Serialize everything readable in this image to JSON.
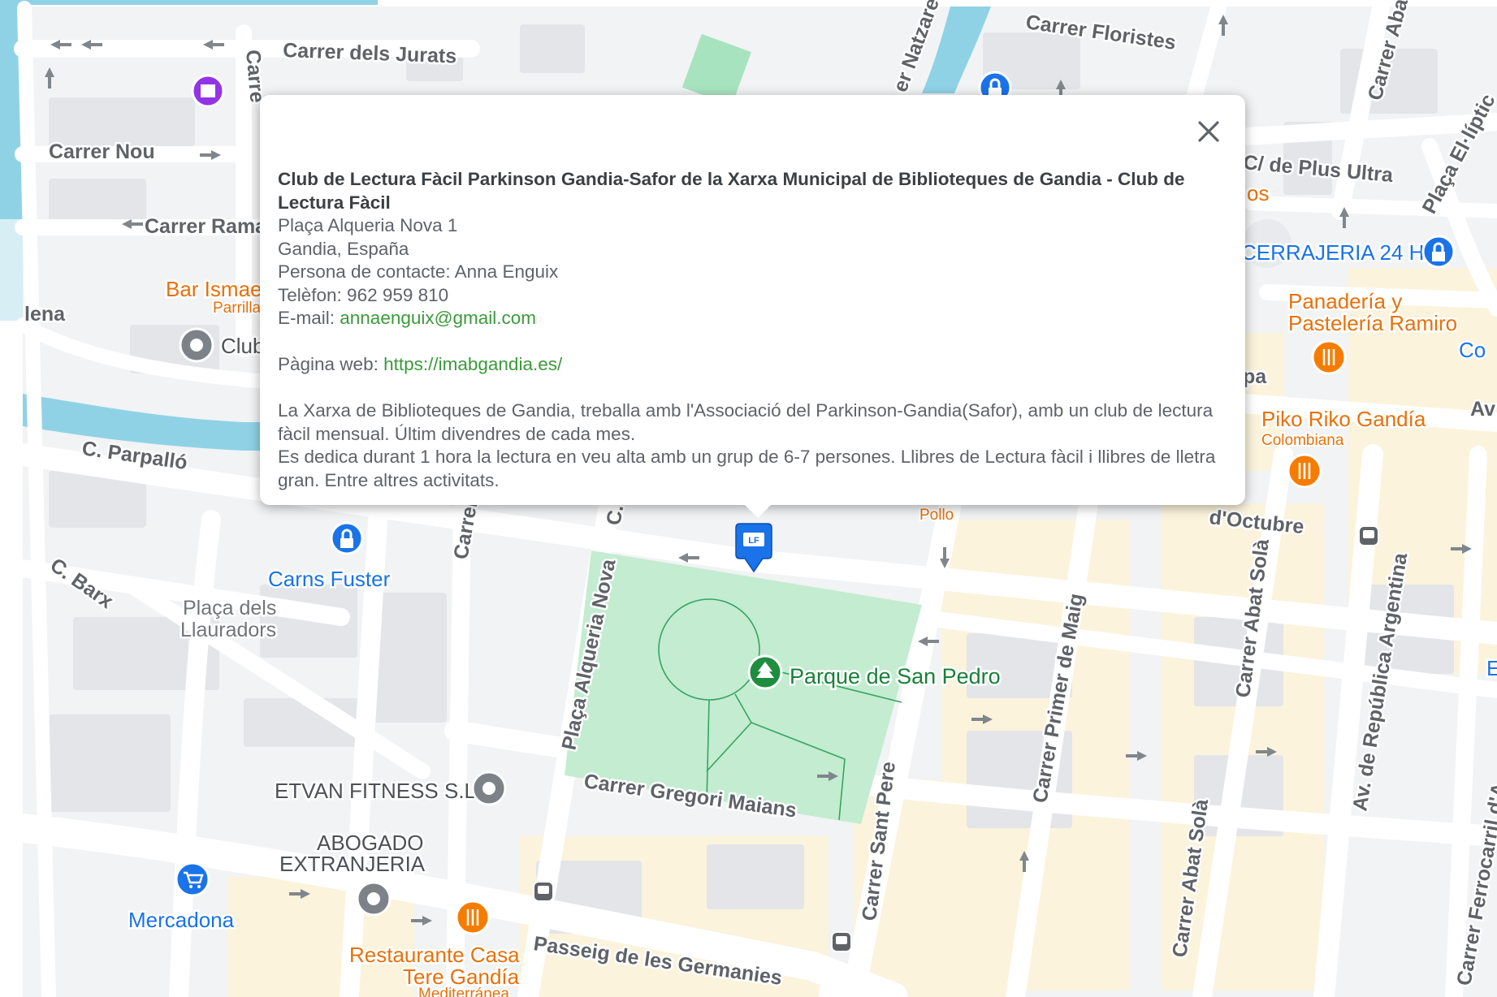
{
  "map": {
    "streets": {
      "jurats": "Carrer dels Jurats",
      "floristes": "Carrer Floristes",
      "natzare": "er Natzare",
      "abat_top": "Carrer Aba",
      "nou": "Carrer Nou",
      "ramat": "Carrer Ramat",
      "carre_v": "Carre",
      "plus_ultra": "C/ de Plus Ultra",
      "placa_eliptica": "Plaça El·líptic",
      "parpallo": "C. Parpalló",
      "barx": "C. Barx",
      "carrer_v": "Carrer",
      "c_v": "C.",
      "octubre": "d'Octubre",
      "alqueria": "Plaça Alqueria Nova",
      "gregori": "Carrer Gregori Maians",
      "sant_pere": "Carrer Sant Pere",
      "primer_maig": "Carrer Primer de Maig",
      "abat_sola": "Carrer Abat Solà",
      "abat_sola2": "Carrer Abat Solà",
      "republica": "Av. de República Argentina",
      "ferrocarril": "Carrer Ferrocarril d'A",
      "germanies": "Passeig de les Germanies",
      "av": "Av",
      "pa": "pa",
      "lena": "lena"
    },
    "pois": {
      "bar_ismael": "Bar Ismae",
      "parrilla": "Parrilla",
      "club": "Club",
      "carns": "Carns Fuster",
      "placa_llauradors_1": "Plaça dels",
      "placa_llauradors_2": "Llauradors",
      "cerrajeria": "CERRAJERIA 24 H",
      "os": "os",
      "panaderia_1": "Panadería y",
      "panaderia_2": "Pastelería Ramiro",
      "co": "Co",
      "piko": "Piko Riko Gandía",
      "colombiana": "Colombiana",
      "pollo": "Pollo",
      "parque": "Parque de San Pedro",
      "etvan": "ETVAN FITNESS S.L",
      "abogado_1": "ABOGADO",
      "abogado_2": "EXTRANJERIA",
      "mercadona": "Mercadona",
      "restaurante_1": "Restaurante Casa",
      "restaurante_2": "Tere Gandía",
      "mediterranea": "Mediterránea",
      "e": "E"
    },
    "marker_label": "LF"
  },
  "info_window": {
    "title": "Club de Lectura Fàcil Parkinson Gandia-Safor de la Xarxa Municipal de Biblioteques de Gandia - Club de Lectura Fàcil",
    "address_line1": "Plaça Alqueria Nova 1",
    "address_line2": "Gandia, España",
    "contact": "Persona de contacte: Anna Enguix",
    "phone": "Telèfon: 962 959 810",
    "email_label": "E-mail: ",
    "email": "annaenguix@gmail.com",
    "web_label": "Pàgina web: ",
    "web": "https://imabgandia.es/",
    "description_1": "La Xarxa de Biblioteques de Gandia, treballa amb l'Associació del Parkinson-Gandia(Safor), amb un club de lectura fàcil mensual. Últim divendres de cada mes.",
    "description_2": "Es dedica durant 1 hora la lectura en veu alta amb un grup de 6-7 persones. Llibres de Lectura fàcil i llibres de lletra gran. Entre altres activitats."
  },
  "colors": {
    "map_bg": "#f1f3f4",
    "road": "#ffffff",
    "block": "#e8eaed",
    "sand": "#fef7e0",
    "park": "#c3ecd1",
    "water": "#8fd2e6",
    "marker_blue": "#1a73e8"
  },
  "icons": [
    "close-icon",
    "library-marker-icon",
    "park-icon",
    "restaurant-icon",
    "shopping-cart-icon",
    "lock-icon",
    "bus-stop-icon",
    "place-icon",
    "museum-icon"
  ]
}
